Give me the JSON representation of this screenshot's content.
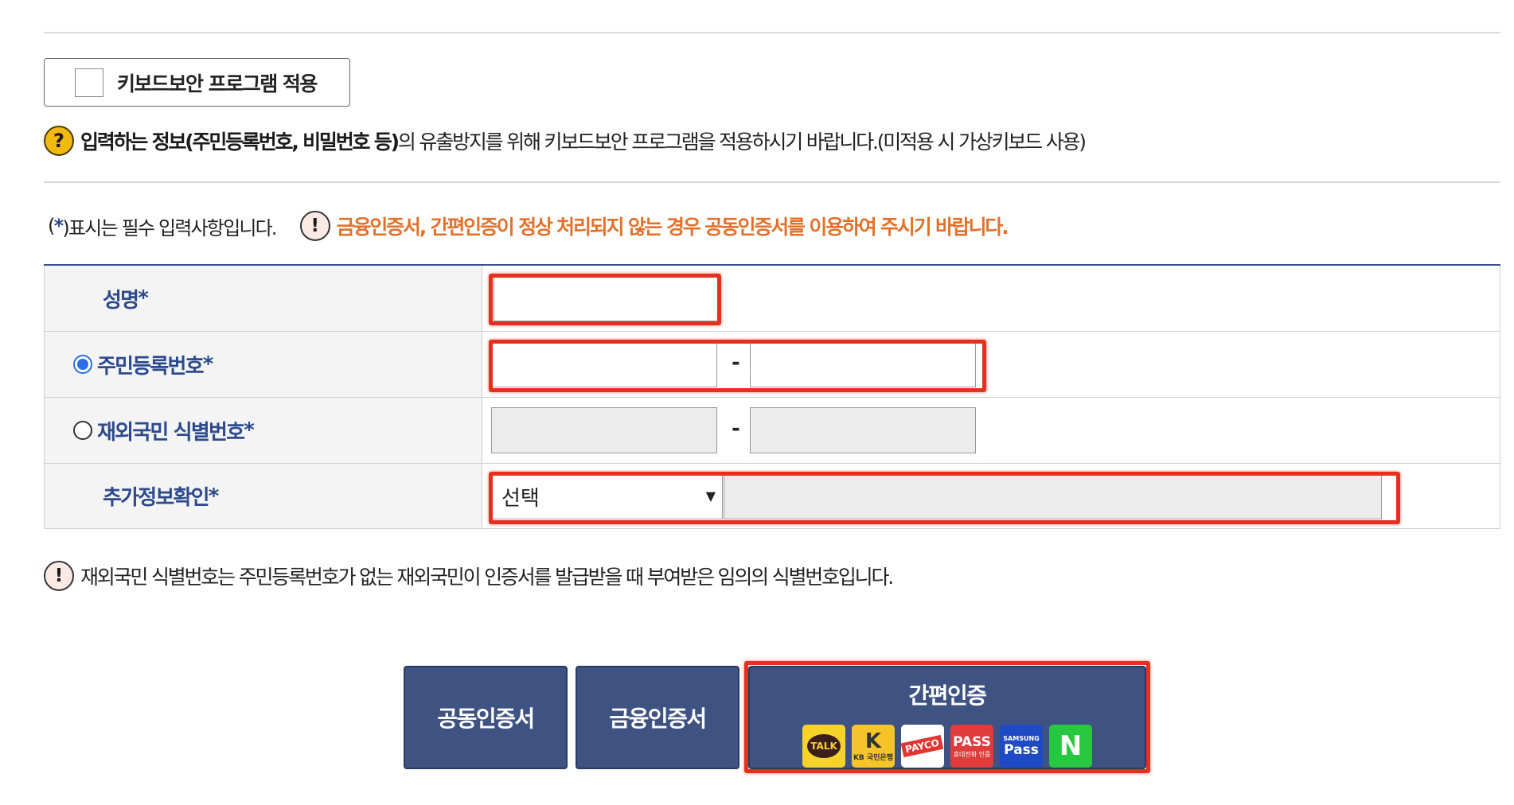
{
  "keyboard_security": {
    "label": "키보드보안 프로그램 적용",
    "checked": false
  },
  "info": {
    "bold": "입력하는 정보(주민등록번호, 비밀번호 등)",
    "rest": "의 유출방지를 위해 키보드보안 프로그램을 적용하시기 바랍니다.(미적용 시 가상키보드 사용)",
    "icon": "?"
  },
  "required_note": {
    "open": "(",
    "star": "*",
    "close": ")표시는 필수 입력사항입니다."
  },
  "warning": {
    "icon": "!",
    "text": "금융인증서, 간편인증이 정상 처리되지 않는 경우 공동인증서를 이용하여 주시기 바랍니다."
  },
  "form": {
    "name_label": "성명",
    "resident_label": "주민등록번호",
    "foreigner_label": "재외국민 식별번호",
    "extra_label": "추가정보확인",
    "star": "*",
    "dash": "-",
    "resident_selected": true,
    "extra_select_value": "선택",
    "select_arrow": "▼"
  },
  "foot_note": {
    "icon": "!",
    "text": "재외국민 식별번호는 주민등록번호가 없는 재외국민이 인증서를 발급받을 때 부여받은 임의의 식별번호입니다."
  },
  "buttons": {
    "joint_cert": "공동인증서",
    "finance_cert": "금융인증서",
    "simple_auth": "간편인증",
    "logos": {
      "kakao": "TALK",
      "kb_big": "K",
      "kb_small": "KB 국민은행",
      "payco": "PAYCO",
      "pass": "PASS",
      "pass_small": "휴대전화 인증",
      "samsung_small": "SAMSUNG",
      "samsung_big": "Pass",
      "naver": "N"
    }
  },
  "colors": {
    "accent_blue": "#2c4a8c",
    "button_bg": "#3f5383",
    "warning_orange": "#e2712b",
    "highlight_red": "#e6301f"
  }
}
